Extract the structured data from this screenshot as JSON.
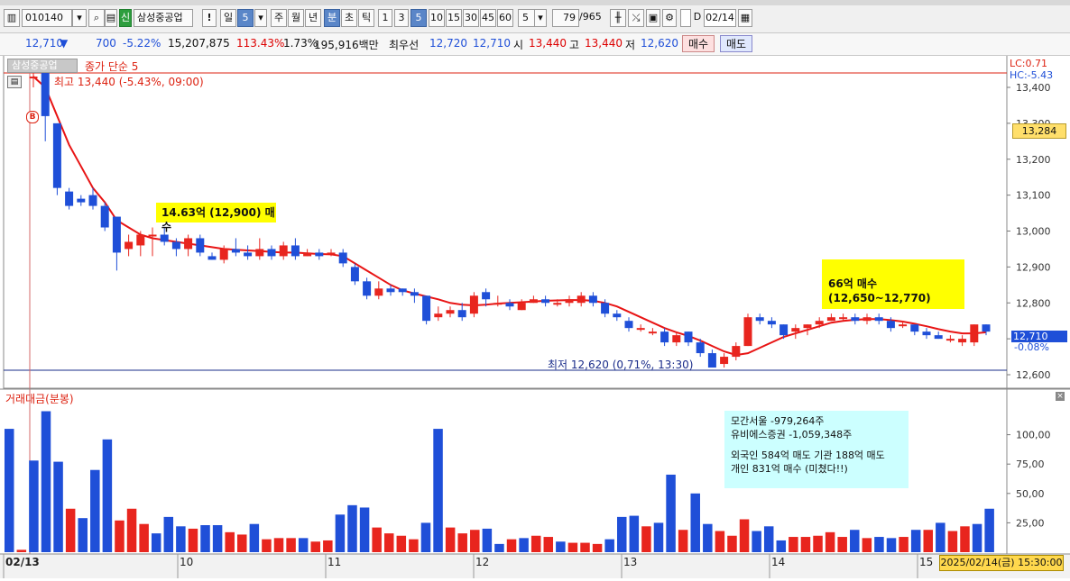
{
  "toolbar": {
    "code": "010140",
    "stock_name": "삼성중공업",
    "badge": "신",
    "periods": [
      "일",
      "5",
      "주",
      "월",
      "년",
      "분",
      "초",
      "틱"
    ],
    "interval_buttons": [
      "1",
      "3",
      "5",
      "10",
      "15",
      "30",
      "45",
      "60"
    ],
    "count_select": "5",
    "page_counter": "79",
    "page_total": "/965",
    "date_check_label": "D",
    "date_value": "02/14"
  },
  "info": {
    "price": "12,710",
    "arrow": "▼",
    "change": "700",
    "change_pct": "-5.22%",
    "volume": "15,207,875",
    "vol_ratio": "113.43%",
    "turnover": "1.73%",
    "amount": "195,916백만",
    "best_label": "최우선",
    "best_ask": "12,720",
    "best_bid": "12,710",
    "open_label": "시",
    "open": "13,440",
    "high_label": "고",
    "high": "13,440",
    "low_label": "저",
    "low": "12,620",
    "buy_button": "매수",
    "sell_button": "매도"
  },
  "chart_panel": {
    "stock_tag": "삼성중공업",
    "indicator_label": "종가 단순 5",
    "high_note": "최고 13,440 (-5.43%, 09:00)",
    "low_note": "최저 12,620 (0,71%, 13:30)",
    "lc_label": "LC:0.71",
    "hc_label": "HC:-5.43",
    "cursor_price": "13,284",
    "current_price_tag": "12,710",
    "current_pct_tag": "-0.08%",
    "buy_marker": "B",
    "annotation1": "14.63억 (12,900) 매수",
    "annotation2": "66억 매수(12,650~12,770)",
    "price_ticks": [
      "13,400",
      "13,300",
      "13,200",
      "13,100",
      "13,000",
      "12,900",
      "12,800",
      "12,700",
      "12,600"
    ]
  },
  "volume_panel": {
    "label": "거래대금(분봉)",
    "ticks": [
      "100,00",
      "75,00",
      "50,00",
      "25,00"
    ],
    "annotation_lines": [
      "모간서울 -979,264주",
      "유비에스증권 -1,059,348주",
      "",
      "외국인 584억 매도 기관 188억 매도",
      "개인 831억 매수 (미쳤다!!)"
    ]
  },
  "x_axis": {
    "labels": [
      "02/13",
      "10",
      "11",
      "12",
      "13",
      "14",
      "15"
    ],
    "timestamp": "2025/02/14(금) 15:30:00"
  },
  "colors": {
    "up": "#e8251e",
    "down": "#1f4fd8",
    "ma": "#e81414",
    "note_bg": "#ffff00",
    "vol_note_bg": "#ccffff"
  },
  "chart_data": {
    "type": "candlestick",
    "ylim": [
      12580,
      13460
    ],
    "candles": [
      {
        "o": 13430,
        "c": 13430,
        "h": 13440,
        "l": 13400
      },
      {
        "o": 13440,
        "c": 13320,
        "h": 13440,
        "l": 13250
      },
      {
        "o": 13300,
        "c": 13120,
        "h": 13300,
        "l": 13100
      },
      {
        "o": 13110,
        "c": 13070,
        "h": 13120,
        "l": 13060
      },
      {
        "o": 13090,
        "c": 13080,
        "h": 13100,
        "l": 13070
      },
      {
        "o": 13100,
        "c": 13070,
        "h": 13120,
        "l": 13060
      },
      {
        "o": 13070,
        "c": 13010,
        "h": 13080,
        "l": 13000
      },
      {
        "o": 13040,
        "c": 12940,
        "h": 13040,
        "l": 12890
      },
      {
        "o": 12950,
        "c": 12970,
        "h": 12990,
        "l": 12930
      },
      {
        "o": 12960,
        "c": 12990,
        "h": 13000,
        "l": 12930
      },
      {
        "o": 12990,
        "c": 12990,
        "h": 13010,
        "l": 12930
      },
      {
        "o": 12990,
        "c": 12970,
        "h": 13010,
        "l": 12960
      },
      {
        "o": 12970,
        "c": 12950,
        "h": 12980,
        "l": 12930
      },
      {
        "o": 12950,
        "c": 12980,
        "h": 12990,
        "l": 12930
      },
      {
        "o": 12980,
        "c": 12940,
        "h": 12990,
        "l": 12930
      },
      {
        "o": 12930,
        "c": 12920,
        "h": 12940,
        "l": 12920
      },
      {
        "o": 12920,
        "c": 12950,
        "h": 12960,
        "l": 12910
      },
      {
        "o": 12950,
        "c": 12940,
        "h": 12980,
        "l": 12930
      },
      {
        "o": 12940,
        "c": 12930,
        "h": 12960,
        "l": 12920
      },
      {
        "o": 12930,
        "c": 12950,
        "h": 12980,
        "l": 12920
      },
      {
        "o": 12950,
        "c": 12930,
        "h": 12960,
        "l": 12920
      },
      {
        "o": 12930,
        "c": 12960,
        "h": 12970,
        "l": 12920
      },
      {
        "o": 12960,
        "c": 12930,
        "h": 12980,
        "l": 12920
      },
      {
        "o": 12930,
        "c": 12940,
        "h": 12950,
        "l": 12930
      },
      {
        "o": 12940,
        "c": 12930,
        "h": 12950,
        "l": 12920
      },
      {
        "o": 12940,
        "c": 12940,
        "h": 12950,
        "l": 12930
      },
      {
        "o": 12940,
        "c": 12910,
        "h": 12950,
        "l": 12900
      },
      {
        "o": 12900,
        "c": 12860,
        "h": 12910,
        "l": 12850
      },
      {
        "o": 12860,
        "c": 12820,
        "h": 12870,
        "l": 12810
      },
      {
        "o": 12820,
        "c": 12840,
        "h": 12860,
        "l": 12810
      },
      {
        "o": 12840,
        "c": 12830,
        "h": 12850,
        "l": 12820
      },
      {
        "o": 12840,
        "c": 12830,
        "h": 12840,
        "l": 12820
      },
      {
        "o": 12830,
        "c": 12820,
        "h": 12840,
        "l": 12800
      },
      {
        "o": 12820,
        "c": 12750,
        "h": 12820,
        "l": 12740
      },
      {
        "o": 12760,
        "c": 12770,
        "h": 12790,
        "l": 12750
      },
      {
        "o": 12770,
        "c": 12780,
        "h": 12790,
        "l": 12760
      },
      {
        "o": 12780,
        "c": 12760,
        "h": 12800,
        "l": 12750
      },
      {
        "o": 12770,
        "c": 12820,
        "h": 12830,
        "l": 12760
      },
      {
        "o": 12830,
        "c": 12810,
        "h": 12840,
        "l": 12790
      },
      {
        "o": 12800,
        "c": 12800,
        "h": 12820,
        "l": 12790
      },
      {
        "o": 12800,
        "c": 12790,
        "h": 12810,
        "l": 12780
      },
      {
        "o": 12780,
        "c": 12800,
        "h": 12810,
        "l": 12780
      },
      {
        "o": 12800,
        "c": 12810,
        "h": 12820,
        "l": 12800
      },
      {
        "o": 12810,
        "c": 12800,
        "h": 12820,
        "l": 12790
      },
      {
        "o": 12800,
        "c": 12800,
        "h": 12810,
        "l": 12790
      },
      {
        "o": 12800,
        "c": 12810,
        "h": 12820,
        "l": 12790
      },
      {
        "o": 12800,
        "c": 12820,
        "h": 12830,
        "l": 12790
      },
      {
        "o": 12820,
        "c": 12800,
        "h": 12830,
        "l": 12790
      },
      {
        "o": 12800,
        "c": 12770,
        "h": 12810,
        "l": 12760
      },
      {
        "o": 12770,
        "c": 12760,
        "h": 12780,
        "l": 12750
      },
      {
        "o": 12750,
        "c": 12730,
        "h": 12760,
        "l": 12720
      },
      {
        "o": 12730,
        "c": 12730,
        "h": 12740,
        "l": 12720
      },
      {
        "o": 12720,
        "c": 12720,
        "h": 12730,
        "l": 12710
      },
      {
        "o": 12720,
        "c": 12690,
        "h": 12730,
        "l": 12680
      },
      {
        "o": 12690,
        "c": 12710,
        "h": 12720,
        "l": 12680
      },
      {
        "o": 12720,
        "c": 12690,
        "h": 12720,
        "l": 12680
      },
      {
        "o": 12690,
        "c": 12660,
        "h": 12700,
        "l": 12650
      },
      {
        "o": 12660,
        "c": 12620,
        "h": 12670,
        "l": 12620
      },
      {
        "o": 12630,
        "c": 12650,
        "h": 12660,
        "l": 12620
      },
      {
        "o": 12650,
        "c": 12680,
        "h": 12690,
        "l": 12640
      },
      {
        "o": 12680,
        "c": 12760,
        "h": 12770,
        "l": 12680
      },
      {
        "o": 12760,
        "c": 12750,
        "h": 12770,
        "l": 12740
      },
      {
        "o": 12750,
        "c": 12740,
        "h": 12760,
        "l": 12730
      },
      {
        "o": 12740,
        "c": 12710,
        "h": 12740,
        "l": 12700
      },
      {
        "o": 12720,
        "c": 12730,
        "h": 12740,
        "l": 12700
      },
      {
        "o": 12730,
        "c": 12740,
        "h": 12740,
        "l": 12710
      },
      {
        "o": 12740,
        "c": 12750,
        "h": 12760,
        "l": 12730
      },
      {
        "o": 12750,
        "c": 12760,
        "h": 12770,
        "l": 12750
      },
      {
        "o": 12760,
        "c": 12760,
        "h": 12770,
        "l": 12750
      },
      {
        "o": 12760,
        "c": 12750,
        "h": 12770,
        "l": 12740
      },
      {
        "o": 12750,
        "c": 12760,
        "h": 12770,
        "l": 12740
      },
      {
        "o": 12760,
        "c": 12750,
        "h": 12770,
        "l": 12740
      },
      {
        "o": 12750,
        "c": 12730,
        "h": 12760,
        "l": 12720
      },
      {
        "o": 12740,
        "c": 12740,
        "h": 12750,
        "l": 12730
      },
      {
        "o": 12740,
        "c": 12720,
        "h": 12740,
        "l": 12710
      },
      {
        "o": 12720,
        "c": 12710,
        "h": 12730,
        "l": 12700
      },
      {
        "o": 12710,
        "c": 12700,
        "h": 12720,
        "l": 12700
      },
      {
        "o": 12700,
        "c": 12700,
        "h": 12710,
        "l": 12690
      },
      {
        "o": 12690,
        "c": 12700,
        "h": 12710,
        "l": 12680
      },
      {
        "o": 12690,
        "c": 12740,
        "h": 12740,
        "l": 12680
      },
      {
        "o": 12740,
        "c": 12720,
        "h": 12740,
        "l": 12710
      }
    ],
    "ma5": [
      13430,
      13400,
      13320,
      13240,
      13180,
      13120,
      13080,
      13030,
      13010,
      12990,
      12980,
      12975,
      12970,
      12965,
      12960,
      12955,
      12950,
      12948,
      12946,
      12944,
      12942,
      12940,
      12940,
      12938,
      12936,
      12935,
      12930,
      12910,
      12890,
      12870,
      12850,
      12835,
      12826,
      12818,
      12810,
      12800,
      12795,
      12793,
      12795,
      12798,
      12800,
      12802,
      12804,
      12806,
      12807,
      12808,
      12808,
      12806,
      12800,
      12790,
      12775,
      12760,
      12745,
      12730,
      12718,
      12708,
      12695,
      12680,
      12665,
      12655,
      12660,
      12675,
      12690,
      12705,
      12715,
      12725,
      12735,
      12745,
      12750,
      12753,
      12755,
      12755,
      12752,
      12748,
      12742,
      12735,
      12727,
      12720,
      12715,
      12715,
      12718
    ],
    "volume": [
      {
        "v": 105,
        "up": false
      },
      {
        "v": 2,
        "up": true
      },
      {
        "v": 78,
        "up": false
      },
      {
        "v": 120,
        "up": false
      },
      {
        "v": 77,
        "up": false
      },
      {
        "v": 37,
        "up": true
      },
      {
        "v": 29,
        "up": false
      },
      {
        "v": 70,
        "up": false
      },
      {
        "v": 96,
        "up": false
      },
      {
        "v": 27,
        "up": true
      },
      {
        "v": 37,
        "up": true
      },
      {
        "v": 24,
        "up": true
      },
      {
        "v": 16,
        "up": false
      },
      {
        "v": 30,
        "up": false
      },
      {
        "v": 22,
        "up": false
      },
      {
        "v": 20,
        "up": true
      },
      {
        "v": 23,
        "up": false
      },
      {
        "v": 23,
        "up": false
      },
      {
        "v": 17,
        "up": true
      },
      {
        "v": 15,
        "up": true
      },
      {
        "v": 24,
        "up": false
      },
      {
        "v": 11,
        "up": true
      },
      {
        "v": 12,
        "up": true
      },
      {
        "v": 12,
        "up": true
      },
      {
        "v": 12,
        "up": false
      },
      {
        "v": 9,
        "up": true
      },
      {
        "v": 10,
        "up": true
      },
      {
        "v": 32,
        "up": false
      },
      {
        "v": 40,
        "up": false
      },
      {
        "v": 38,
        "up": false
      },
      {
        "v": 21,
        "up": true
      },
      {
        "v": 16,
        "up": true
      },
      {
        "v": 14,
        "up": true
      },
      {
        "v": 11,
        "up": true
      },
      {
        "v": 25,
        "up": false
      },
      {
        "v": 105,
        "up": false
      },
      {
        "v": 21,
        "up": true
      },
      {
        "v": 16,
        "up": true
      },
      {
        "v": 19,
        "up": true
      },
      {
        "v": 20,
        "up": false
      },
      {
        "v": 7,
        "up": false
      },
      {
        "v": 11,
        "up": true
      },
      {
        "v": 12,
        "up": false
      },
      {
        "v": 14,
        "up": true
      },
      {
        "v": 13,
        "up": true
      },
      {
        "v": 9,
        "up": false
      },
      {
        "v": 8,
        "up": true
      },
      {
        "v": 8,
        "up": true
      },
      {
        "v": 7,
        "up": true
      },
      {
        "v": 11,
        "up": false
      },
      {
        "v": 30,
        "up": false
      },
      {
        "v": 31,
        "up": false
      },
      {
        "v": 22,
        "up": true
      },
      {
        "v": 25,
        "up": false
      },
      {
        "v": 66,
        "up": false
      },
      {
        "v": 19,
        "up": true
      },
      {
        "v": 50,
        "up": false
      },
      {
        "v": 24,
        "up": false
      },
      {
        "v": 18,
        "up": true
      },
      {
        "v": 14,
        "up": true
      },
      {
        "v": 28,
        "up": true
      },
      {
        "v": 18,
        "up": false
      },
      {
        "v": 22,
        "up": false
      },
      {
        "v": 10,
        "up": false
      },
      {
        "v": 13,
        "up": true
      },
      {
        "v": 13,
        "up": true
      },
      {
        "v": 14,
        "up": true
      },
      {
        "v": 17,
        "up": true
      },
      {
        "v": 13,
        "up": true
      },
      {
        "v": 19,
        "up": false
      },
      {
        "v": 12,
        "up": true
      },
      {
        "v": 13,
        "up": false
      },
      {
        "v": 12,
        "up": false
      },
      {
        "v": 13,
        "up": true
      },
      {
        "v": 19,
        "up": false
      },
      {
        "v": 19,
        "up": true
      },
      {
        "v": 25,
        "up": false
      },
      {
        "v": 18,
        "up": true
      },
      {
        "v": 22,
        "up": true
      },
      {
        "v": 24,
        "up": false
      },
      {
        "v": 37,
        "up": false
      }
    ],
    "vol_max": 125
  }
}
